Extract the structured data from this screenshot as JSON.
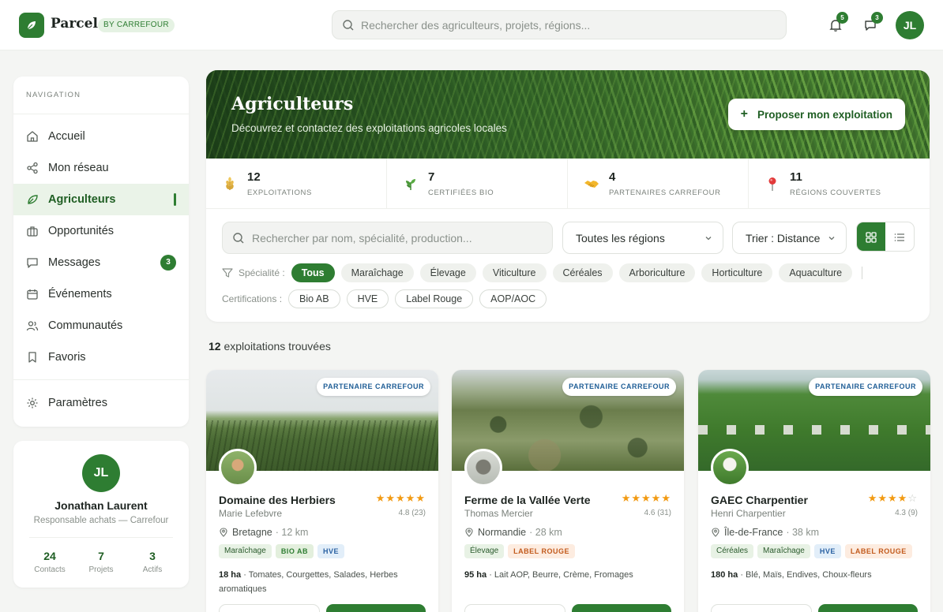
{
  "topbar": {
    "logo": "Parcel",
    "badge": "BY CARREFOUR",
    "search_placeholder": "Rechercher des agriculteurs, projets, régions...",
    "notifications_count": "5",
    "messages_count": "3",
    "avatar_initials": "JL"
  },
  "sidebar": {
    "heading": "NAVIGATION",
    "items": [
      {
        "label": "Accueil",
        "icon": "home-icon"
      },
      {
        "label": "Mon réseau",
        "icon": "share-network-icon"
      },
      {
        "label": "Agriculteurs",
        "icon": "leaf-icon",
        "active": true
      },
      {
        "label": "Opportunités",
        "icon": "briefcase-icon"
      },
      {
        "label": "Messages",
        "icon": "chat-icon",
        "badge": "3"
      },
      {
        "label": "Événements",
        "icon": "calendar-icon"
      },
      {
        "label": "Communautés",
        "icon": "users-icon"
      },
      {
        "label": "Favoris",
        "icon": "bookmark-icon"
      }
    ],
    "settings": {
      "label": "Paramètres",
      "icon": "gear-icon"
    }
  },
  "profile": {
    "initials": "JL",
    "name": "Jonathan Laurent",
    "role": "Responsable achats — Carrefour",
    "stats": [
      {
        "value": "24",
        "label": "Contacts"
      },
      {
        "value": "7",
        "label": "Projets"
      },
      {
        "value": "3",
        "label": "Actifs"
      }
    ]
  },
  "hero": {
    "title": "Agriculteurs",
    "subtitle": "Découvrez et contactez des exploitations agricoles locales",
    "cta": "Proposer mon exploitation"
  },
  "stats": [
    {
      "value": "12",
      "label": "EXPLOITATIONS",
      "icon": "wheat-icon"
    },
    {
      "value": "7",
      "label": "CERTIFIÉES BIO",
      "icon": "herb-icon"
    },
    {
      "value": "4",
      "label": "PARTENAIRES CARREFOUR",
      "icon": "handshake-icon"
    },
    {
      "value": "11",
      "label": "RÉGIONS COUVERTES",
      "icon": "map-pin-icon"
    }
  ],
  "filters": {
    "search_placeholder": "Rechercher par nom, spécialité, production...",
    "region_select": "Toutes les régions",
    "sort_select": "Trier : Distance",
    "specialty_label": "Spécialité :",
    "specialties": [
      "Tous",
      "Maraîchage",
      "Élevage",
      "Viticulture",
      "Céréales",
      "Arboriculture",
      "Horticulture",
      "Aquaculture"
    ],
    "active_specialty": "Tous",
    "certifications_label": "Certifications :",
    "certifications": [
      "Bio AB",
      "HVE",
      "Label Rouge",
      "AOP/AOC"
    ]
  },
  "results": {
    "count": "12",
    "text": "exploitations trouvées"
  },
  "cards": [
    {
      "partner": "PARTENAIRE CARREFOUR",
      "name": "Domaine des Herbiers",
      "owner": "Marie Lefebvre",
      "stars": "★★★★★",
      "empty_stars": "",
      "rating": "4.8 (23)",
      "region": "Bretagne",
      "distance": "· 12 km",
      "tags": [
        {
          "label": "Maraîchage",
          "kind": "spec"
        },
        {
          "label": "BIO AB",
          "kind": "bio"
        },
        {
          "label": "HVE",
          "kind": "hve"
        }
      ],
      "surface": "18 ha",
      "products": "· Tomates, Courgettes, Salades, Herbes aromatiques"
    },
    {
      "partner": "PARTENAIRE CARREFOUR",
      "name": "Ferme de la Vallée Verte",
      "owner": "Thomas Mercier",
      "stars": "★★★★★",
      "empty_stars": "",
      "rating": "4.6 (31)",
      "region": "Normandie",
      "distance": "· 28 km",
      "tags": [
        {
          "label": "Élevage",
          "kind": "spec"
        },
        {
          "label": "LABEL ROUGE",
          "kind": "lr"
        }
      ],
      "surface": "95 ha",
      "products": "· Lait AOP, Beurre, Crème, Fromages"
    },
    {
      "partner": "PARTENAIRE CARREFOUR",
      "name": "GAEC Charpentier",
      "owner": "Henri Charpentier",
      "stars": "★★★★",
      "empty_stars": "☆",
      "rating": "4.3 (9)",
      "region": "Île-de-France",
      "distance": "· 38 km",
      "tags": [
        {
          "label": "Céréales",
          "kind": "spec"
        },
        {
          "label": "Maraîchage",
          "kind": "spec"
        },
        {
          "label": "HVE",
          "kind": "hve"
        },
        {
          "label": "LABEL ROUGE",
          "kind": "lr"
        }
      ],
      "surface": "180 ha",
      "products": "· Blé, Maïs, Endives, Choux-fleurs"
    }
  ]
}
